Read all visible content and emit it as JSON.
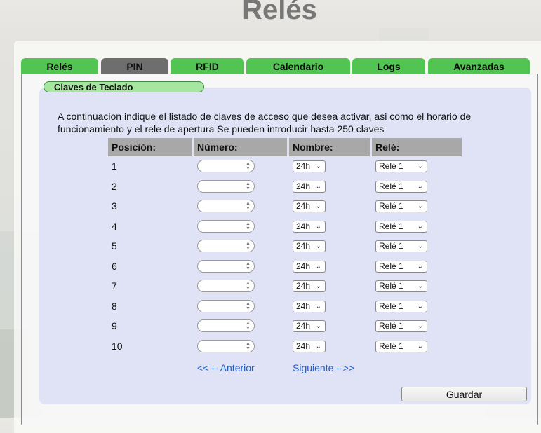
{
  "page": {
    "title": "Relés"
  },
  "tabs": [
    {
      "label": "Relés",
      "active": false
    },
    {
      "label": "PIN",
      "active": true
    },
    {
      "label": "RFID",
      "active": false
    },
    {
      "label": "Calendario",
      "active": false
    },
    {
      "label": "Logs",
      "active": false
    },
    {
      "label": "Avanzadas",
      "active": false
    }
  ],
  "section": {
    "label": "Claves de Teclado",
    "description": "A continuacion indique el listado de claves de acceso que desea activar, asi como el horario de funcionamiento y el rele de apertura Se pueden introducir hasta 250 claves"
  },
  "table": {
    "headers": [
      "Posición:",
      "Número:",
      "Nombre:",
      "Relé:"
    ],
    "rows": [
      {
        "position": "1",
        "number": "",
        "schedule": "24h",
        "relay": "Relé 1"
      },
      {
        "position": "2",
        "number": "",
        "schedule": "24h",
        "relay": "Relé 1"
      },
      {
        "position": "3",
        "number": "",
        "schedule": "24h",
        "relay": "Relé 1"
      },
      {
        "position": "4",
        "number": "",
        "schedule": "24h",
        "relay": "Relé 1"
      },
      {
        "position": "5",
        "number": "",
        "schedule": "24h",
        "relay": "Relé 1"
      },
      {
        "position": "6",
        "number": "",
        "schedule": "24h",
        "relay": "Relé 1"
      },
      {
        "position": "7",
        "number": "",
        "schedule": "24h",
        "relay": "Relé 1"
      },
      {
        "position": "8",
        "number": "",
        "schedule": "24h",
        "relay": "Relé 1"
      },
      {
        "position": "9",
        "number": "",
        "schedule": "24h",
        "relay": "Relé 1"
      },
      {
        "position": "10",
        "number": "",
        "schedule": "24h",
        "relay": "Relé 1"
      }
    ]
  },
  "pagination": {
    "prev_label": "<< -- Anterior",
    "next_label": "Siguiente -->>"
  },
  "actions": {
    "save_label": "Guardar"
  },
  "colors": {
    "tab_green": "#52c452",
    "tab_active": "#6e6e6e",
    "header_gray": "#a8a8a8",
    "link_blue": "#1a5fd0"
  }
}
